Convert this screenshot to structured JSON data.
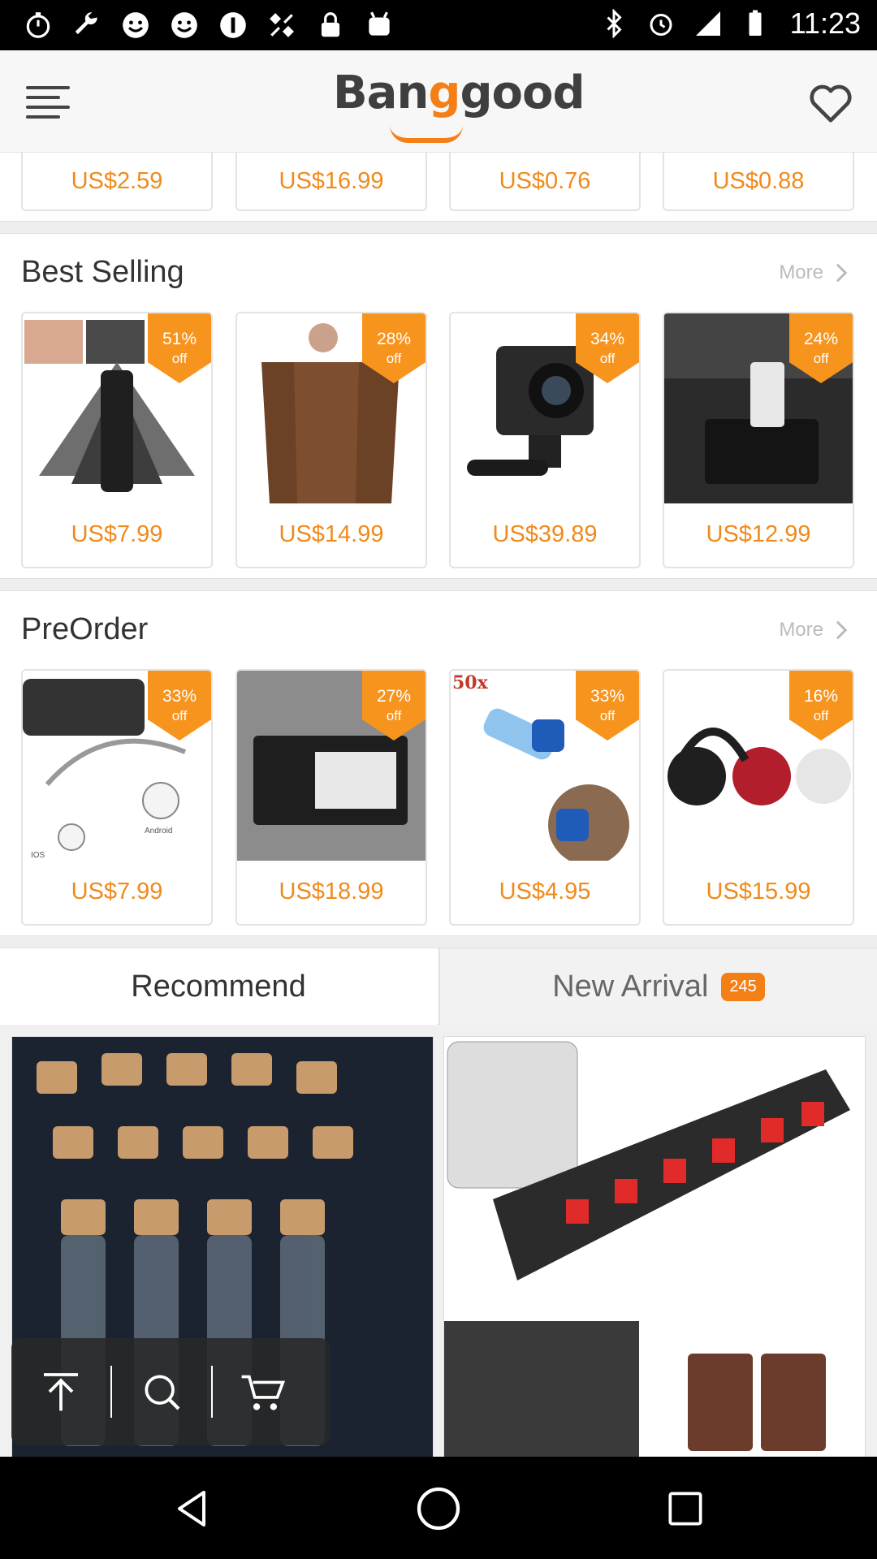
{
  "status_bar": {
    "time": "11:23",
    "left_icons": [
      "stopwatch-icon",
      "wrench-icon",
      "smiley-icon",
      "smiley-icon",
      "info-icon",
      "no-gps-icon",
      "lock-icon",
      "android-icon"
    ],
    "right_icons": [
      "bluetooth-icon",
      "alarm-icon",
      "signal-icon",
      "battery-icon"
    ]
  },
  "header": {
    "logo_prefix": "Ban",
    "logo_g": "g",
    "logo_suffix": "good"
  },
  "top_prices": [
    "US$2.59",
    "US$16.99",
    "US$0.76",
    "US$0.88"
  ],
  "best_selling": {
    "title": "Best Selling",
    "more_label": "More",
    "items": [
      {
        "price": "US$7.99",
        "pct": "51%",
        "off": "off",
        "image": "black-mask-product"
      },
      {
        "price": "US$14.99",
        "pct": "28%",
        "off": "off",
        "image": "brown-towel-dress"
      },
      {
        "price": "US$39.89",
        "pct": "34%",
        "off": "off",
        "image": "4k-action-camera"
      },
      {
        "price": "US$12.99",
        "pct": "24%",
        "off": "off",
        "image": "car-phone-holder"
      }
    ]
  },
  "preorder": {
    "title": "PreOrder",
    "more_label": "More",
    "items": [
      {
        "price": "US$7.99",
        "pct": "33%",
        "off": "off",
        "image": "magnetic-cable",
        "ios_label": "IOS",
        "android_label": "Android"
      },
      {
        "price": "US$18.99",
        "pct": "27%",
        "off": "off",
        "image": "solar-wall-light"
      },
      {
        "price": "US$4.95",
        "pct": "33%",
        "off": "off",
        "image": "wire-connectors",
        "count_label": "50x"
      },
      {
        "price": "US$15.99",
        "pct": "16%",
        "off": "off",
        "image": "headphones"
      }
    ]
  },
  "tabs": {
    "recommend": "Recommend",
    "new_arrival": "New Arrival",
    "new_arrival_count": "245"
  },
  "feed": [
    "cork-glass-vials",
    "speaker-terminal-board"
  ],
  "colors": {
    "accent": "#f57f17",
    "price": "#f08a1c",
    "badge": "#f7941d"
  }
}
